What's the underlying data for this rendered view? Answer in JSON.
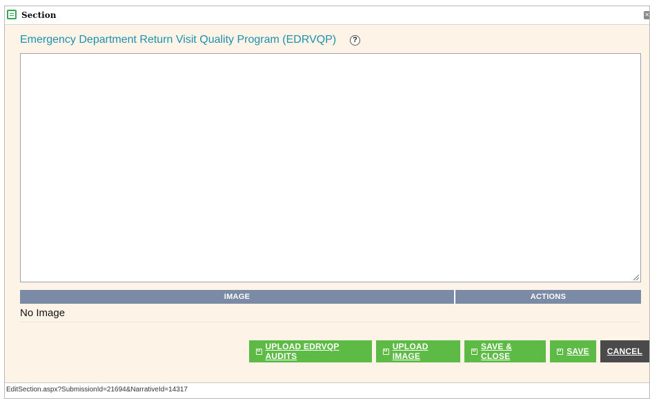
{
  "window": {
    "title": "Section",
    "close_icon": "close-icon"
  },
  "form": {
    "heading": "Emergency Department Return Visit Quality Program (EDRVQP)",
    "help_icon_glyph": "?",
    "editor_value": ""
  },
  "image_grid": {
    "columns": [
      "IMAGE",
      "ACTIONS"
    ],
    "empty_text": "No Image"
  },
  "buttons": {
    "upload_audits": "UPLOAD EDRVQP AUDITS",
    "upload_image": "UPLOAD IMAGE",
    "save_close": "SAVE & CLOSE",
    "save": "SAVE",
    "cancel": "CANCEL"
  },
  "colors": {
    "heading": "#1f8fae",
    "grid_header": "#7b8aa5",
    "button_green": "#5cba45",
    "button_dark": "#4a4a4a",
    "panel_bg": "#fdf3e7"
  },
  "status": {
    "url": "EditSection.aspx?SubmissionId=21694&NarrativeId=14317"
  }
}
